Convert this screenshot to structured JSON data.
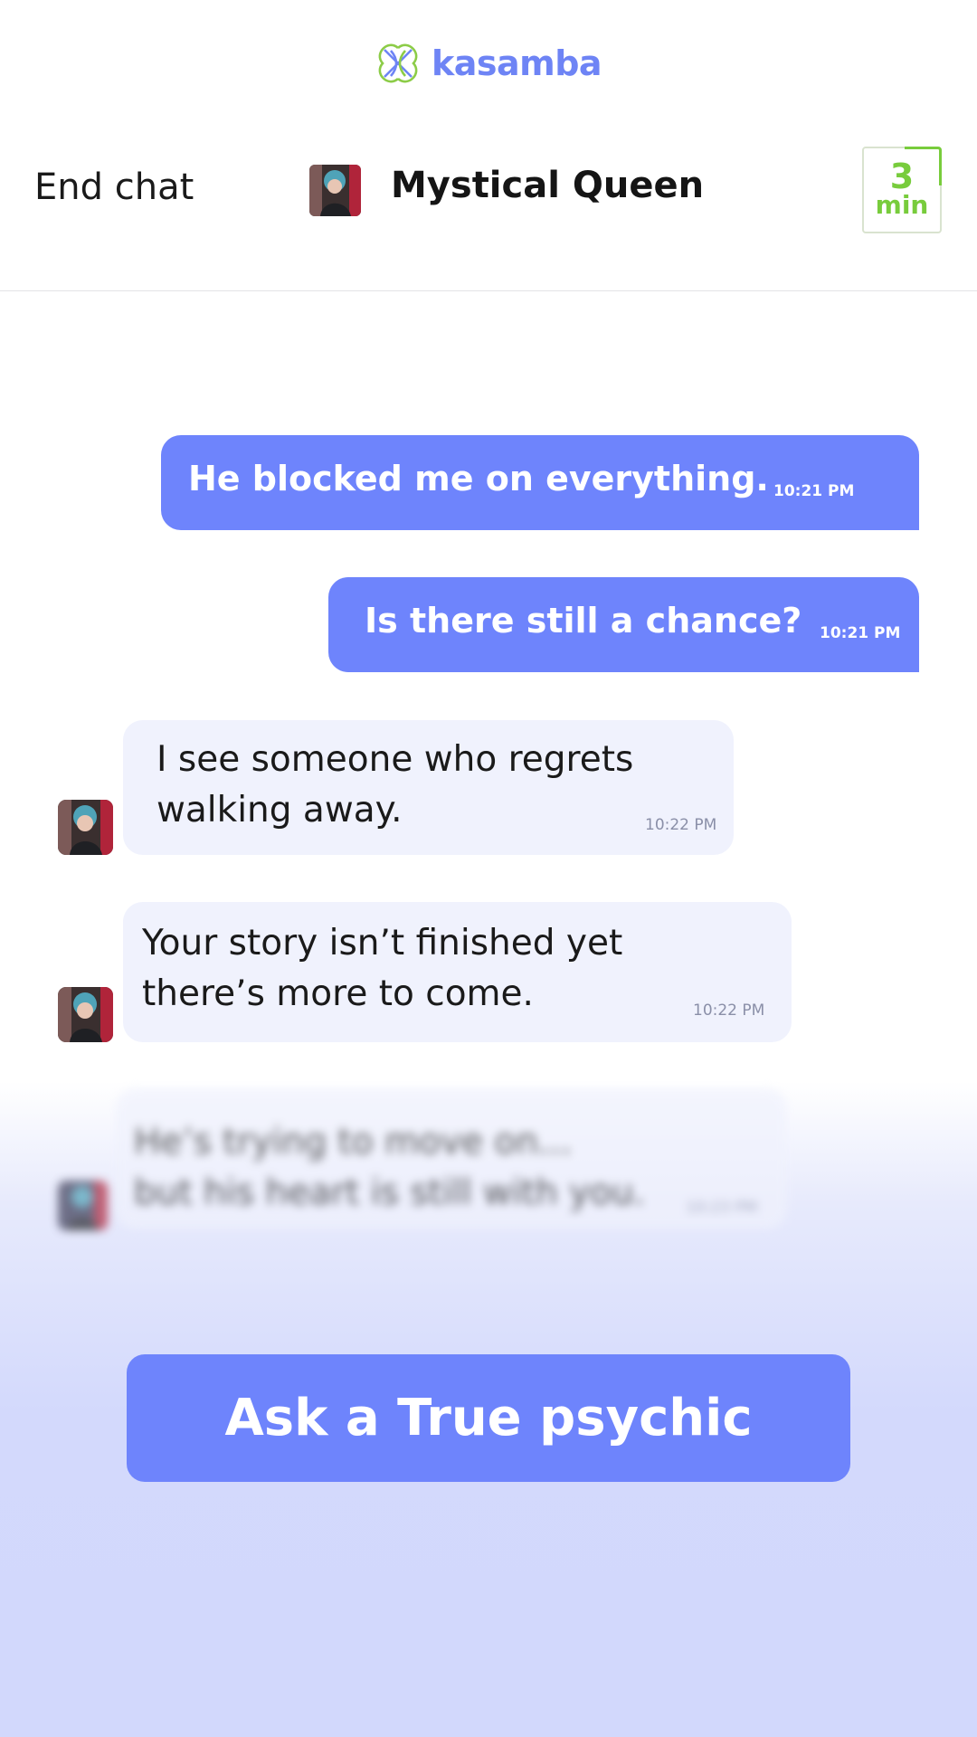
{
  "brand": {
    "name": "kasamba",
    "logo_icon": "kasamba-logo-icon",
    "logo_colors": [
      "#8ccc47",
      "#6e84f5"
    ]
  },
  "header": {
    "end_chat_label": "End chat",
    "psychic_name": "Mystical Queen",
    "avatar_icon": "psychic-avatar",
    "timer": {
      "value": "3",
      "unit": "min",
      "color": "#78cc3c"
    }
  },
  "messages": [
    {
      "direction": "outgoing",
      "text": "He blocked me on everything.",
      "time": "10:21 PM"
    },
    {
      "direction": "outgoing",
      "text": "Is there still a chance?",
      "time": "10:21 PM"
    },
    {
      "direction": "incoming",
      "lines": [
        "I see someone who regrets",
        "walking away."
      ],
      "time": "10:22 PM"
    },
    {
      "direction": "incoming",
      "lines": [
        "Your story isn’t finished yet",
        "there’s more to come."
      ],
      "time": "10:22 PM"
    },
    {
      "direction": "incoming",
      "blurred": true,
      "lines": [
        "He’s trying to move on...",
        "but his heart is still with you."
      ],
      "time": "10:23 PM"
    }
  ],
  "cta": {
    "label": "Ask a True psychic"
  },
  "colors": {
    "accent": "#6e84fc",
    "incoming_bubble": "#f0f2fd",
    "timer_green": "#78cc3c"
  }
}
